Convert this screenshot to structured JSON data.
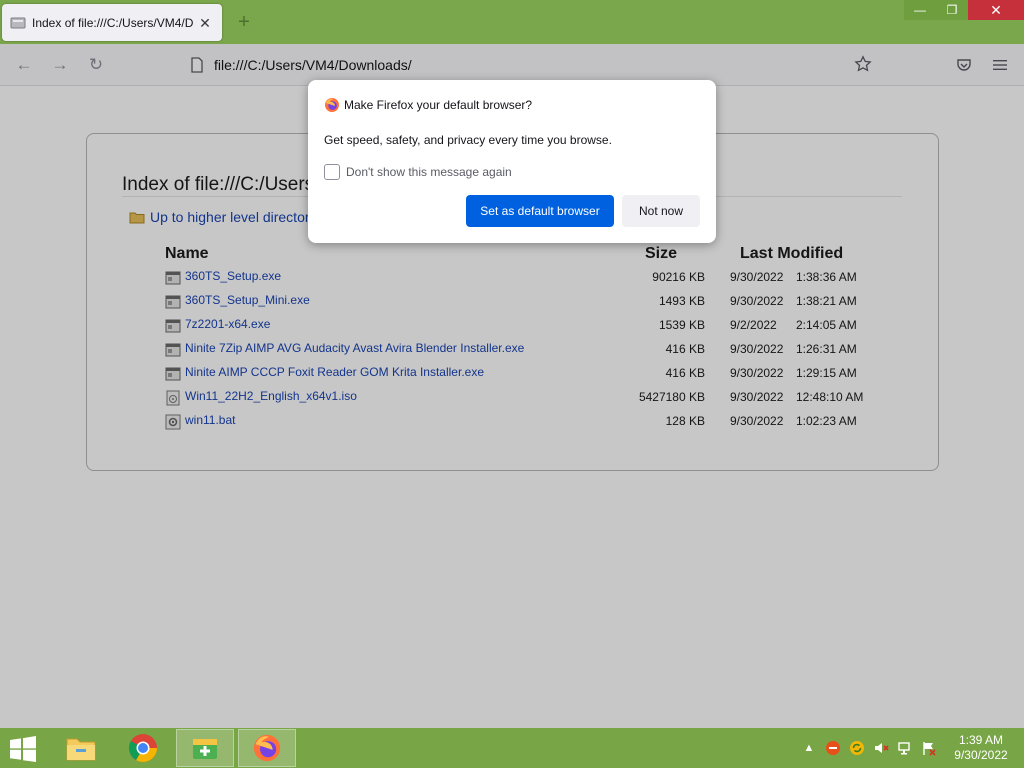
{
  "window": {
    "tab_title": "Index of file:///C:/Users/VM4/D",
    "new_tab": "+",
    "minimize": "—",
    "restore": "❐",
    "close": "✕"
  },
  "navbar": {
    "back_glyph": "←",
    "forward_glyph": "→",
    "reload_glyph": "↻",
    "url": "file:///C:/Users/VM4/Downloads/"
  },
  "page": {
    "title": "Index of file:///C:/Users",
    "up_link": "Up to higher level directory",
    "columns": {
      "name": "Name",
      "size": "Size",
      "modified": "Last Modified"
    },
    "files": [
      {
        "name": "360TS_Setup.exe",
        "size": "90216 KB",
        "date": "9/30/2022",
        "time": "1:38:36 AM",
        "icon": "exe-icon"
      },
      {
        "name": "360TS_Setup_Mini.exe",
        "size": "1493 KB",
        "date": "9/30/2022",
        "time": "1:38:21 AM",
        "icon": "exe-icon"
      },
      {
        "name": "7z2201-x64.exe",
        "size": "1539 KB",
        "date": "9/2/2022",
        "time": "2:14:05 AM",
        "icon": "exe-icon"
      },
      {
        "name": "Ninite 7Zip AIMP AVG Audacity Avast Avira Blender Installer.exe",
        "size": "416 KB",
        "date": "9/30/2022",
        "time": "1:26:31 AM",
        "icon": "exe-icon"
      },
      {
        "name": "Ninite AIMP CCCP Foxit Reader GOM Krita Installer.exe",
        "size": "416 KB",
        "date": "9/30/2022",
        "time": "1:29:15 AM",
        "icon": "exe-icon"
      },
      {
        "name": "Win11_22H2_English_x64v1.iso",
        "size": "5427180 KB",
        "date": "9/30/2022",
        "time": "12:48:10 AM",
        "icon": "iso-icon"
      },
      {
        "name": "win11.bat",
        "size": "128 KB",
        "date": "9/30/2022",
        "time": "1:02:23 AM",
        "icon": "bat-icon"
      }
    ]
  },
  "dialog": {
    "title": "Make Firefox your default browser?",
    "body": "Get speed, safety, and privacy every time you browse.",
    "checkbox_label": "Don't show this message again",
    "primary_button": "Set as default browser",
    "secondary_button": "Not now"
  },
  "taskbar": {
    "clock_time": "1:39 AM",
    "clock_date": "9/30/2022",
    "tray_arrow": "▲"
  },
  "colors": {
    "accent": "#0061e0",
    "taskbar": "#78a546",
    "link": "#1a44b4"
  }
}
